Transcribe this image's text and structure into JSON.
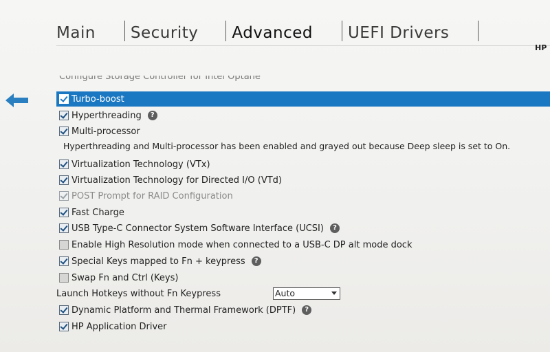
{
  "tabs": {
    "main": "Main",
    "security": "Security",
    "advanced": "Advanced",
    "uefi": "UEFI Drivers"
  },
  "header": {
    "hp": "HP"
  },
  "icons": {
    "back": "back-arrow-icon",
    "help": "help-icon"
  },
  "colors": {
    "selection": "#1a78c2",
    "arrow": "#2a7fc0"
  },
  "partial_row": "Configure Storage Controller for Intel Optane",
  "settings": {
    "turbo_boost": {
      "label": "Turbo-boost",
      "checked": true
    },
    "hyperthreading": {
      "label": "Hyperthreading",
      "checked": true
    },
    "multi_processor": {
      "label": "Multi-processor",
      "checked": true
    },
    "info_note": "Hyperthreading and Multi-processor has been enabled and grayed out because Deep sleep is set to On.",
    "vtx": {
      "label": "Virtualization Technology (VTx)",
      "checked": true
    },
    "vtd": {
      "label": "Virtualization Technology for Directed I/O (VTd)",
      "checked": true
    },
    "raid_post": {
      "label": "POST Prompt for RAID Configuration",
      "checked": true,
      "disabled": true
    },
    "fast_charge": {
      "label": "Fast Charge",
      "checked": true
    },
    "ucsi": {
      "label": "USB Type-C Connector System Software Interface (UCSI)",
      "checked": true
    },
    "high_res": {
      "label": "Enable High Resolution mode when connected to a USB-C DP alt mode dock",
      "checked": false
    },
    "special_keys": {
      "label": "Special Keys mapped to Fn + keypress",
      "checked": true
    },
    "swap_fn": {
      "label": "Swap Fn and Ctrl (Keys)",
      "checked": false
    },
    "launch_hotkeys": {
      "label": "Launch Hotkeys without Fn Keypress",
      "value": "Auto"
    },
    "dptf": {
      "label": "Dynamic Platform and Thermal Framework (DPTF)",
      "checked": true
    },
    "hp_app_driver": {
      "label": "HP Application Driver",
      "checked": true
    }
  }
}
